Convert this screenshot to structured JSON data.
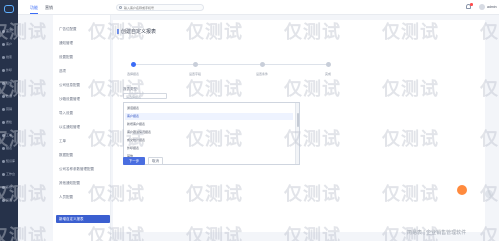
{
  "app": {
    "accent": "#3b6cf6",
    "nav_bg": "#26324a"
  },
  "nav": {
    "items": [
      {
        "label": "首页",
        "icon": "home-icon"
      },
      {
        "label": "客户",
        "icon": "user-icon"
      },
      {
        "label": "线索",
        "icon": "lead-icon"
      },
      {
        "label": "外呼",
        "icon": "phone-icon"
      },
      {
        "label": "短信",
        "icon": "message-icon"
      },
      {
        "label": "数据",
        "icon": "chart-icon"
      },
      {
        "label": "营销",
        "icon": "megaphone-icon"
      },
      {
        "label": "质检",
        "icon": "check-icon"
      },
      {
        "label": "工单",
        "icon": "ticket-icon"
      },
      {
        "label": "报表",
        "icon": "report-icon"
      },
      {
        "label": "知识库",
        "icon": "book-icon"
      },
      {
        "label": "工作台",
        "icon": "desk-icon"
      },
      {
        "label": "系统",
        "icon": "gear-icon"
      },
      {
        "label": "设置",
        "icon": "settings-icon"
      }
    ]
  },
  "header": {
    "tabs": [
      {
        "label": "功能"
      },
      {
        "label": "营销"
      }
    ],
    "search_placeholder": "输入客户名称或手机号",
    "user_name": "admin"
  },
  "submenu": {
    "items": [
      {
        "label": "广告位配置"
      },
      {
        "label": "通知管理"
      },
      {
        "label": "设置配置"
      },
      {
        "label": "选项"
      },
      {
        "label": "公司信息配置"
      },
      {
        "label": "沙箱设置管理"
      },
      {
        "label": "导入设置"
      },
      {
        "label": "以往通知管理"
      },
      {
        "label": "工单"
      },
      {
        "label": "数据配置"
      },
      {
        "label": "公司名称参数管理配置"
      },
      {
        "label": "其他通知配置"
      },
      {
        "label": "人员配置"
      }
    ],
    "active_label": "新增自定义报表"
  },
  "form": {
    "title": "创建自定义报表",
    "steps": [
      {
        "label": "选择报表"
      },
      {
        "label": "设置字段"
      },
      {
        "label": "设置条件"
      },
      {
        "label": "完成"
      }
    ],
    "field_label": "报表类型：",
    "select_placeholder": "请选择报表",
    "options": [
      {
        "label": "通话报表"
      },
      {
        "label": "客户报表"
      },
      {
        "label": "新增客户报表"
      },
      {
        "label": "客户跟进情况报表"
      },
      {
        "label": "成交统计报表"
      },
      {
        "label": "外呼报表"
      },
      {
        "label": "其他"
      }
    ],
    "highlighted_index": 1,
    "next_label": "下一步",
    "cancel_label": "取消"
  },
  "watermark": {
    "text": "仅测试"
  },
  "footer_mark": "简易表 | 企业销售管理软件"
}
